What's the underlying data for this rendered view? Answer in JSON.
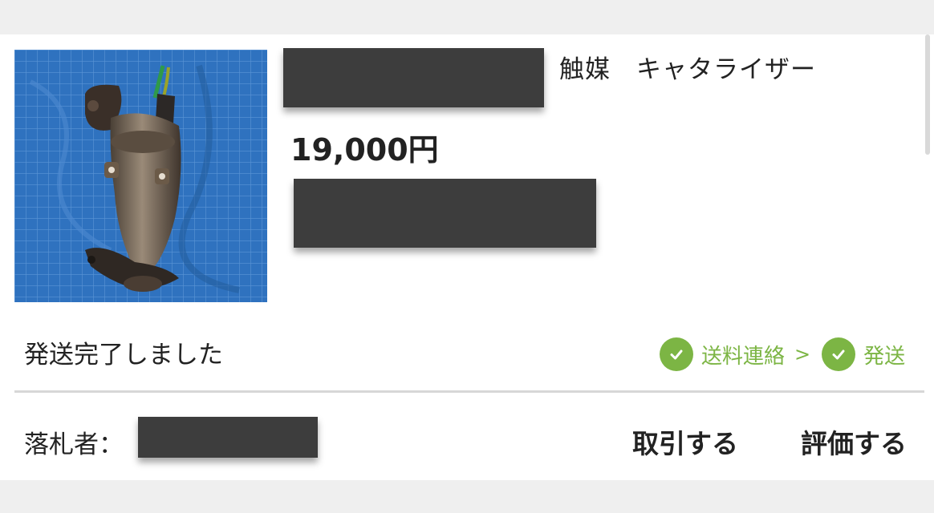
{
  "item": {
    "title": "触媒　キャタライザー",
    "price": "19,000円",
    "image_alt": "catalytic converter on blue tarp"
  },
  "status": {
    "text": "発送完了しました",
    "steps": [
      {
        "label": "送料連絡",
        "done": true,
        "icon": "check-icon"
      },
      {
        "label": "発送",
        "done": true,
        "icon": "check-icon"
      }
    ],
    "separator": ">"
  },
  "bidder": {
    "label": "落札者："
  },
  "actions": {
    "trade": "取引する",
    "review": "評価する"
  },
  "colors": {
    "accent_green": "#7cb544",
    "background": "#efefef",
    "card": "#ffffff",
    "redaction": "#3d3d3d",
    "tarp_blue": "#2f73c0"
  }
}
